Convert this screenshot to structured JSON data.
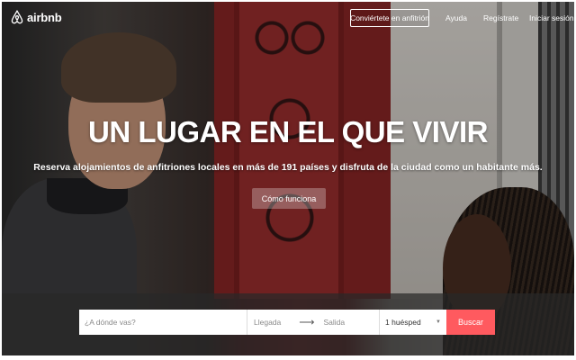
{
  "header": {
    "brand": "airbnb",
    "logo_icon": "airbnb-belo-icon",
    "host_button": "Conviértete en anfitrión",
    "links": {
      "help": "Ayuda",
      "register": "Regístrate",
      "login": "Iniciar sesión"
    }
  },
  "hero": {
    "title": "UN LUGAR EN EL QUE VIVIR",
    "subtitle": "Reserva alojamientos de anfitriones locales en más de 191 países y disfruta de la ciudad como un habitante más.",
    "cta": "Cómo funciona"
  },
  "search": {
    "where_placeholder": "¿A dónde vas?",
    "checkin_placeholder": "Llegada",
    "arrow_icon": "arrow-right-icon",
    "checkout_placeholder": "Salida",
    "guests_value": "1 huésped",
    "guests_icon": "caret-down-icon",
    "submit_label": "Buscar"
  },
  "colors": {
    "accent": "#ff5a5f",
    "overlay": "#282828"
  }
}
